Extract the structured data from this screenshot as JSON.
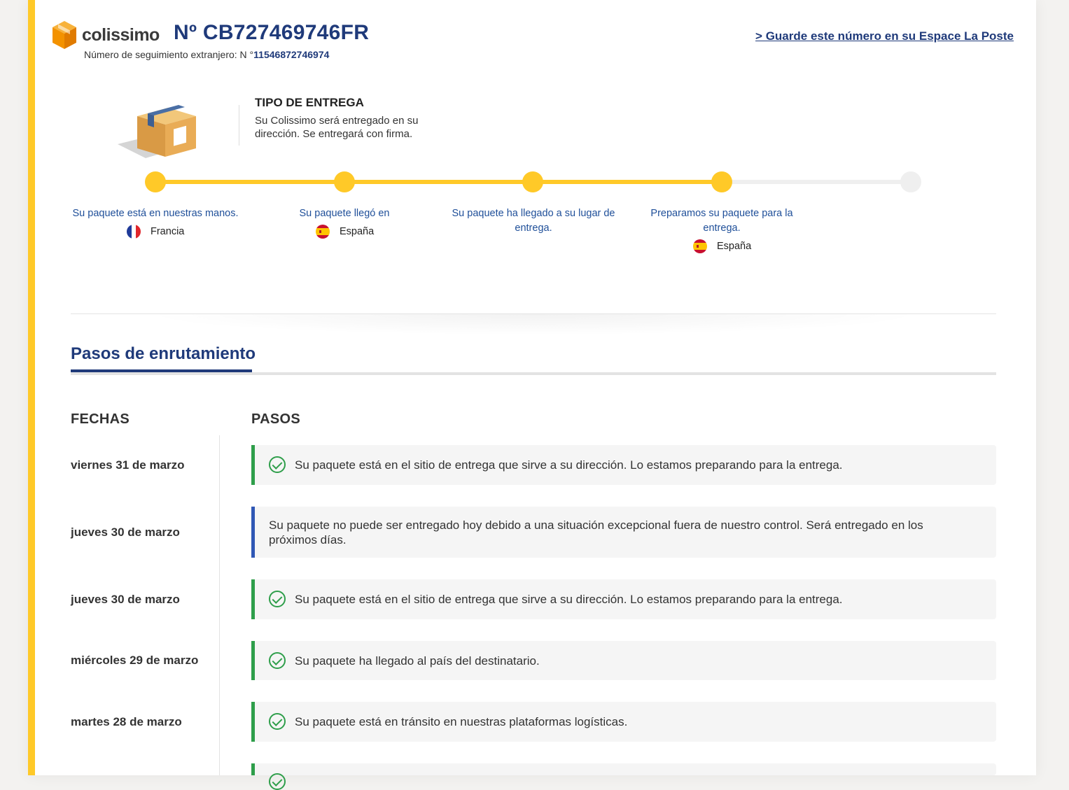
{
  "header": {
    "brand": "colissimo",
    "tracking_number": "Nº CB727469746FR",
    "foreign_label": "Número de seguimiento extranjero: N °",
    "foreign_number": "11546872746974",
    "save_link": "> Guarde este número en su Espace La Poste"
  },
  "delivery": {
    "title": "TIPO DE ENTREGA",
    "description": "Su Colissimo será entregado en su dirección. Se entregará con firma."
  },
  "progress": {
    "completed_steps": 4,
    "total_steps": 5,
    "steps": [
      {
        "label": "Su paquete está en nuestras manos.",
        "country": "Francia"
      },
      {
        "label": "Su paquete llegó en",
        "country": "España"
      },
      {
        "label": "Su paquete ha llegado a su lugar de entrega.",
        "country": ""
      },
      {
        "label": "Preparamos su paquete para la entrega.",
        "country": "España"
      }
    ]
  },
  "routing": {
    "title": "Pasos de enrutamiento",
    "col_dates": "FECHAS",
    "col_steps": "PASOS",
    "events": [
      {
        "date": "viernes 31 de marzo",
        "text": "Su paquete está en el sitio de entrega que sirve a su dirección. Lo estamos preparando para la entrega.",
        "status": "check"
      },
      {
        "date": "jueves 30 de marzo",
        "text": "Su paquete no puede ser entregado hoy debido a una situación excepcional fuera de nuestro control. Será entregado en los próximos días.",
        "status": "info"
      },
      {
        "date": "jueves 30 de marzo",
        "text": "Su paquete está en el sitio de entrega que sirve a su dirección. Lo estamos preparando para la entrega.",
        "status": "check"
      },
      {
        "date": "miércoles 29 de marzo",
        "text": "Su paquete ha llegado al país del destinatario.",
        "status": "check"
      },
      {
        "date": "martes 28 de marzo",
        "text": "Su paquete está en tránsito en nuestras plataformas logísticas.",
        "status": "check"
      }
    ]
  },
  "colors": {
    "accent_yellow": "#ffc928",
    "brand_blue": "#1f3a7a",
    "link_blue": "#1f4f99",
    "success_green": "#2e9e4a",
    "info_blue": "#2f57b5"
  }
}
